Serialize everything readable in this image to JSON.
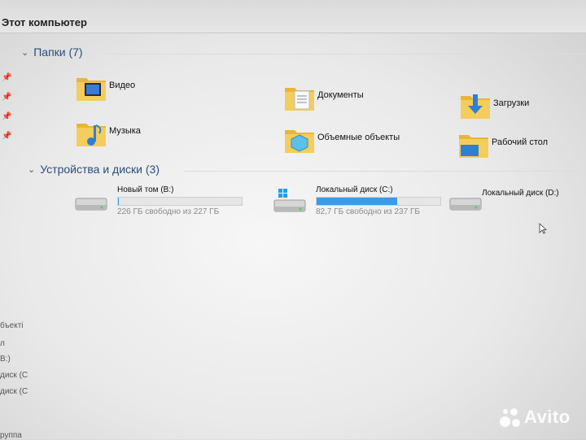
{
  "window": {
    "title": "Этот компьютер"
  },
  "folders_section": {
    "header": "Папки (7)",
    "items": [
      {
        "label": "Видео",
        "icon": "video-folder-icon"
      },
      {
        "label": "Документы",
        "icon": "documents-folder-icon"
      },
      {
        "label": "Загрузки",
        "icon": "downloads-folder-icon"
      },
      {
        "label": "Музыка",
        "icon": "music-folder-icon"
      },
      {
        "label": "Объемные объекты",
        "icon": "3d-objects-folder-icon"
      },
      {
        "label": "Рабочий стол",
        "icon": "desktop-folder-icon"
      }
    ]
  },
  "devices_section": {
    "header": "Устройства и диски (3)",
    "items": [
      {
        "name": "Новый том (B:)",
        "free_text": "226 ГБ свободно из 227 ГБ",
        "used_fraction": 0.004
      },
      {
        "name": "Локальный диск (C:)",
        "free_text": "82,7 ГБ свободно из 237 ГБ",
        "used_fraction": 0.65
      },
      {
        "name": "Локальный диск (D:)",
        "free_text": "",
        "used_fraction": null
      }
    ]
  },
  "sidebar": {
    "truncated_items": [
      "бъекті",
      "л",
      "B:)",
      "диск (С",
      "диск (С",
      "руппа"
    ]
  },
  "watermark": {
    "text": "Avito"
  },
  "colors": {
    "accent": "#3c9be6",
    "folder": "#f2c34d",
    "header_text": "#2a4d7a"
  }
}
